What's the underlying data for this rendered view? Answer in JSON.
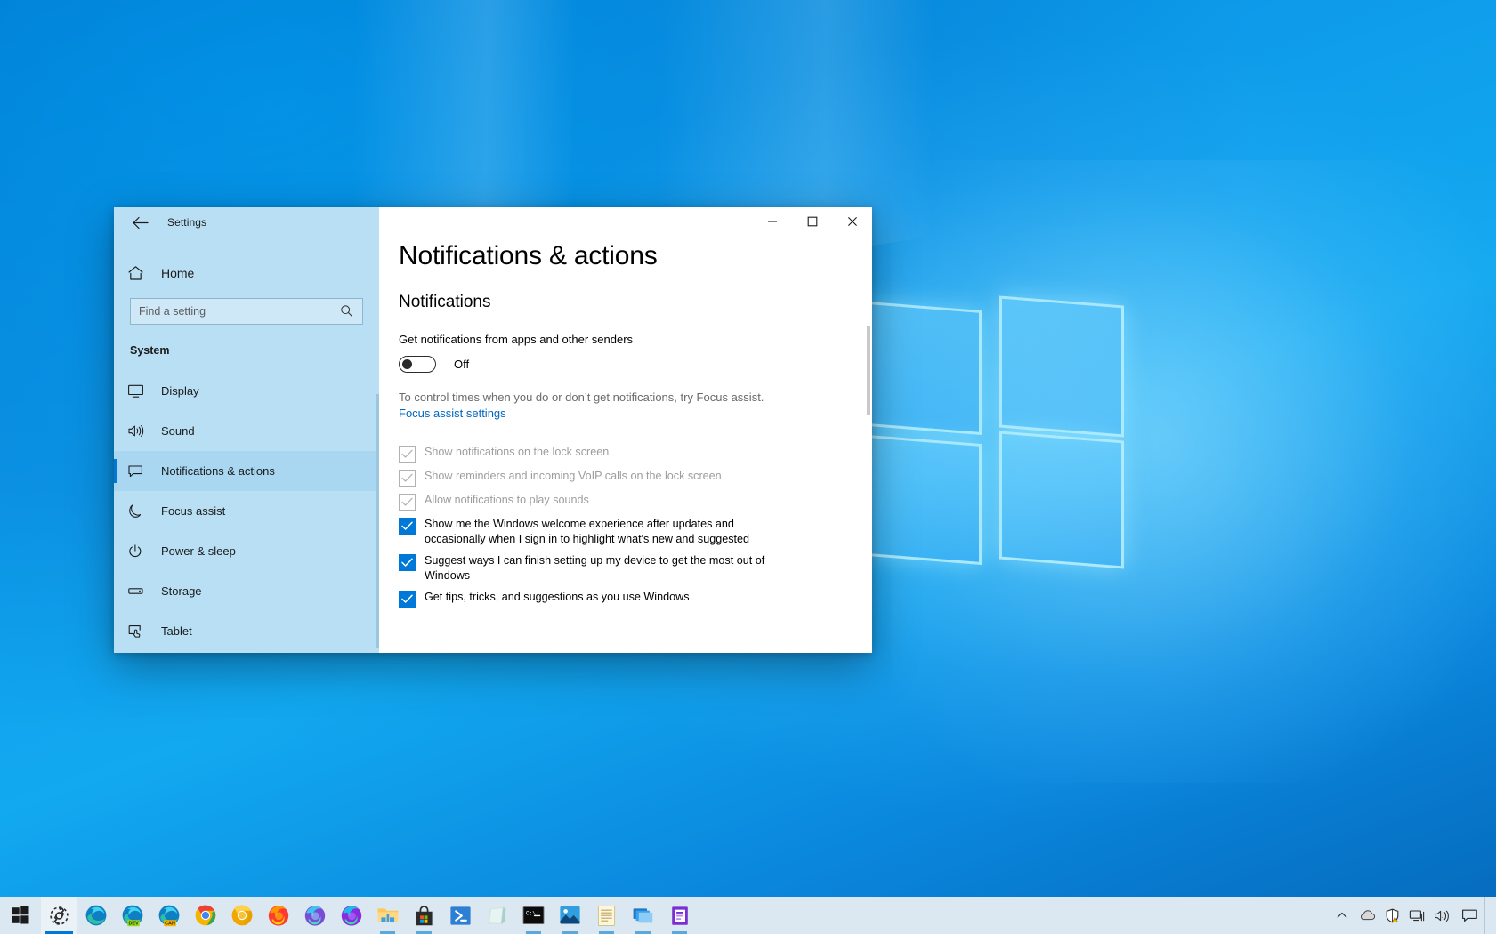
{
  "colors": {
    "accent": "#0078d7",
    "sidebar_bg": "#b9dff4",
    "taskbar_bg": "#dbe7f1",
    "link": "#0067c0",
    "disabled_text": "#9d9d9d"
  },
  "window": {
    "titlebar": {
      "back_icon": "back-arrow-icon",
      "title": "Settings",
      "minimize_label": "—",
      "maximize_label": "☐",
      "close_label": "✕"
    }
  },
  "sidebar": {
    "home": {
      "label": "Home",
      "icon": "home-icon"
    },
    "search": {
      "placeholder": "Find a setting",
      "value": "",
      "icon": "search-icon"
    },
    "group_heading": "System",
    "items": [
      {
        "label": "Display",
        "icon": "monitor-icon",
        "selected": false
      },
      {
        "label": "Sound",
        "icon": "speaker-icon",
        "selected": false
      },
      {
        "label": "Notifications & actions",
        "icon": "chat-bubble-icon",
        "selected": true
      },
      {
        "label": "Focus assist",
        "icon": "moon-icon",
        "selected": false
      },
      {
        "label": "Power & sleep",
        "icon": "power-icon",
        "selected": false
      },
      {
        "label": "Storage",
        "icon": "drive-icon",
        "selected": false
      },
      {
        "label": "Tablet",
        "icon": "tablet-touch-icon",
        "selected": false
      }
    ]
  },
  "main": {
    "page_title": "Notifications & actions",
    "section_heading": "Notifications",
    "toggle": {
      "label": "Get notifications from apps and other senders",
      "state": "Off",
      "checked": false
    },
    "hint_text": "To control times when you do or don’t get notifications, try Focus assist.",
    "focus_link": "Focus assist settings",
    "checkboxes": [
      {
        "label": "Show notifications on the lock screen",
        "checked": true,
        "disabled": true
      },
      {
        "label": "Show reminders and incoming VoIP calls on the lock screen",
        "checked": true,
        "disabled": true
      },
      {
        "label": "Allow notifications to play sounds",
        "checked": true,
        "disabled": true
      },
      {
        "label": "Show me the Windows welcome experience after updates and occasionally when I sign in to highlight what's new and suggested",
        "checked": true,
        "disabled": false
      },
      {
        "label": "Suggest ways I can finish setting up my device to get the most out of Windows",
        "checked": true,
        "disabled": false
      },
      {
        "label": "Get tips, tricks, and suggestions as you use Windows",
        "checked": true,
        "disabled": false
      }
    ]
  },
  "taskbar": {
    "start": {
      "icon": "windows-start-icon"
    },
    "apps": [
      {
        "name": "settings-taskbar-icon",
        "label": "Settings",
        "state": "active"
      },
      {
        "name": "edge-taskbar-icon",
        "label": "Microsoft Edge",
        "state": "pinned"
      },
      {
        "name": "edge-dev-taskbar-icon",
        "label": "Microsoft Edge Dev",
        "badge": "DEV",
        "state": "pinned"
      },
      {
        "name": "edge-canary-taskbar-icon",
        "label": "Microsoft Edge Canary",
        "badge": "CAN",
        "state": "pinned"
      },
      {
        "name": "chrome-taskbar-icon",
        "label": "Google Chrome",
        "state": "pinned"
      },
      {
        "name": "chrome-canary-taskbar-icon",
        "label": "Chrome Canary",
        "state": "pinned"
      },
      {
        "name": "firefox-taskbar-icon",
        "label": "Firefox",
        "state": "pinned"
      },
      {
        "name": "firefox-dev-taskbar-icon",
        "label": "Firefox Developer Edition",
        "state": "pinned"
      },
      {
        "name": "firefox-nightly-taskbar-icon",
        "label": "Firefox Nightly",
        "state": "pinned"
      },
      {
        "name": "file-explorer-taskbar-icon",
        "label": "File Explorer",
        "state": "open"
      },
      {
        "name": "microsoft-store-taskbar-icon",
        "label": "Microsoft Store",
        "state": "open"
      },
      {
        "name": "powershell-taskbar-icon",
        "label": "Windows PowerShell",
        "state": "pinned"
      },
      {
        "name": "sticky-notes-taskbar-icon",
        "label": "Sticky Notes",
        "state": "pinned"
      },
      {
        "name": "command-prompt-taskbar-icon",
        "label": "Command Prompt",
        "state": "open"
      },
      {
        "name": "photos-taskbar-icon",
        "label": "Photos",
        "state": "open"
      },
      {
        "name": "notepad-taskbar-icon",
        "label": "Notepad",
        "state": "open"
      },
      {
        "name": "remote-desktop-taskbar-icon",
        "label": "Remote Desktop",
        "state": "open"
      },
      {
        "name": "app-taskbar-icon",
        "label": "App",
        "state": "open"
      }
    ],
    "tray": {
      "show_hidden_icons": "chevron-up-icon",
      "onedrive": "cloud-icon",
      "security": "shield-warning-icon",
      "network": "network-icon",
      "volume": "volume-icon",
      "action_center": "action-center-icon"
    }
  }
}
